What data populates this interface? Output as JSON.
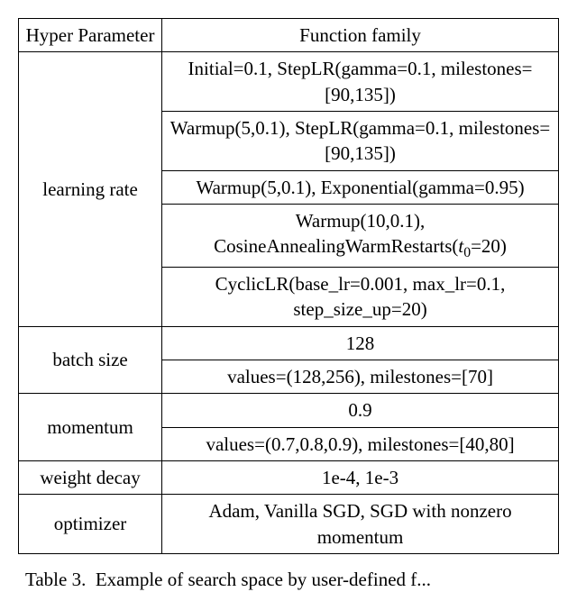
{
  "header": {
    "param": "Hyper Parameter",
    "func": "Function family"
  },
  "rows": {
    "learning_rate": {
      "label": "learning rate",
      "cells": [
        "Initial=0.1, StepLR(gamma=0.1, milestones=[90,135])",
        "Warmup(5,0.1), StepLR(gamma=0.1, milestones=[90,135])",
        "Warmup(5,0.1), Exponential(gamma=0.95)",
        "Warmup(10,0.1), CosineAnnealingWarmRestarts(t0=20)",
        "CyclicLR(base_lr=0.001, max_lr=0.1, step_size_up=20)"
      ]
    },
    "batch_size": {
      "label": "batch size",
      "cells": [
        "128",
        "values=(128,256), milestones=[70]"
      ]
    },
    "momentum": {
      "label": "momentum",
      "cells": [
        "0.9",
        "values=(0.7,0.8,0.9), milestones=[40,80]"
      ]
    },
    "weight_decay": {
      "label": "weight decay",
      "cell": "1e-4, 1e-3"
    },
    "optimizer": {
      "label": "optimizer",
      "cell": "Adam, Vanilla SGD, SGD with nonzero momentum"
    }
  },
  "caption_prefix": "Table 3.",
  "caption_text": "Example of search space by user-defined f...",
  "chart_data": {
    "type": "table",
    "title": "Hyper Parameter vs Function family",
    "columns": [
      "Hyper Parameter",
      "Function family"
    ],
    "rows": [
      [
        "learning rate",
        "Initial=0.1, StepLR(gamma=0.1, milestones=[90,135])"
      ],
      [
        "learning rate",
        "Warmup(5,0.1), StepLR(gamma=0.1, milestones=[90,135])"
      ],
      [
        "learning rate",
        "Warmup(5,0.1), Exponential(gamma=0.95)"
      ],
      [
        "learning rate",
        "Warmup(10,0.1), CosineAnnealingWarmRestarts(t0=20)"
      ],
      [
        "learning rate",
        "CyclicLR(base_lr=0.001, max_lr=0.1, step_size_up=20)"
      ],
      [
        "batch size",
        "128"
      ],
      [
        "batch size",
        "values=(128,256), milestones=[70]"
      ],
      [
        "momentum",
        "0.9"
      ],
      [
        "momentum",
        "values=(0.7,0.8,0.9), milestones=[40,80]"
      ],
      [
        "weight decay",
        "1e-4, 1e-3"
      ],
      [
        "optimizer",
        "Adam, Vanilla SGD, SGD with nonzero momentum"
      ]
    ]
  }
}
